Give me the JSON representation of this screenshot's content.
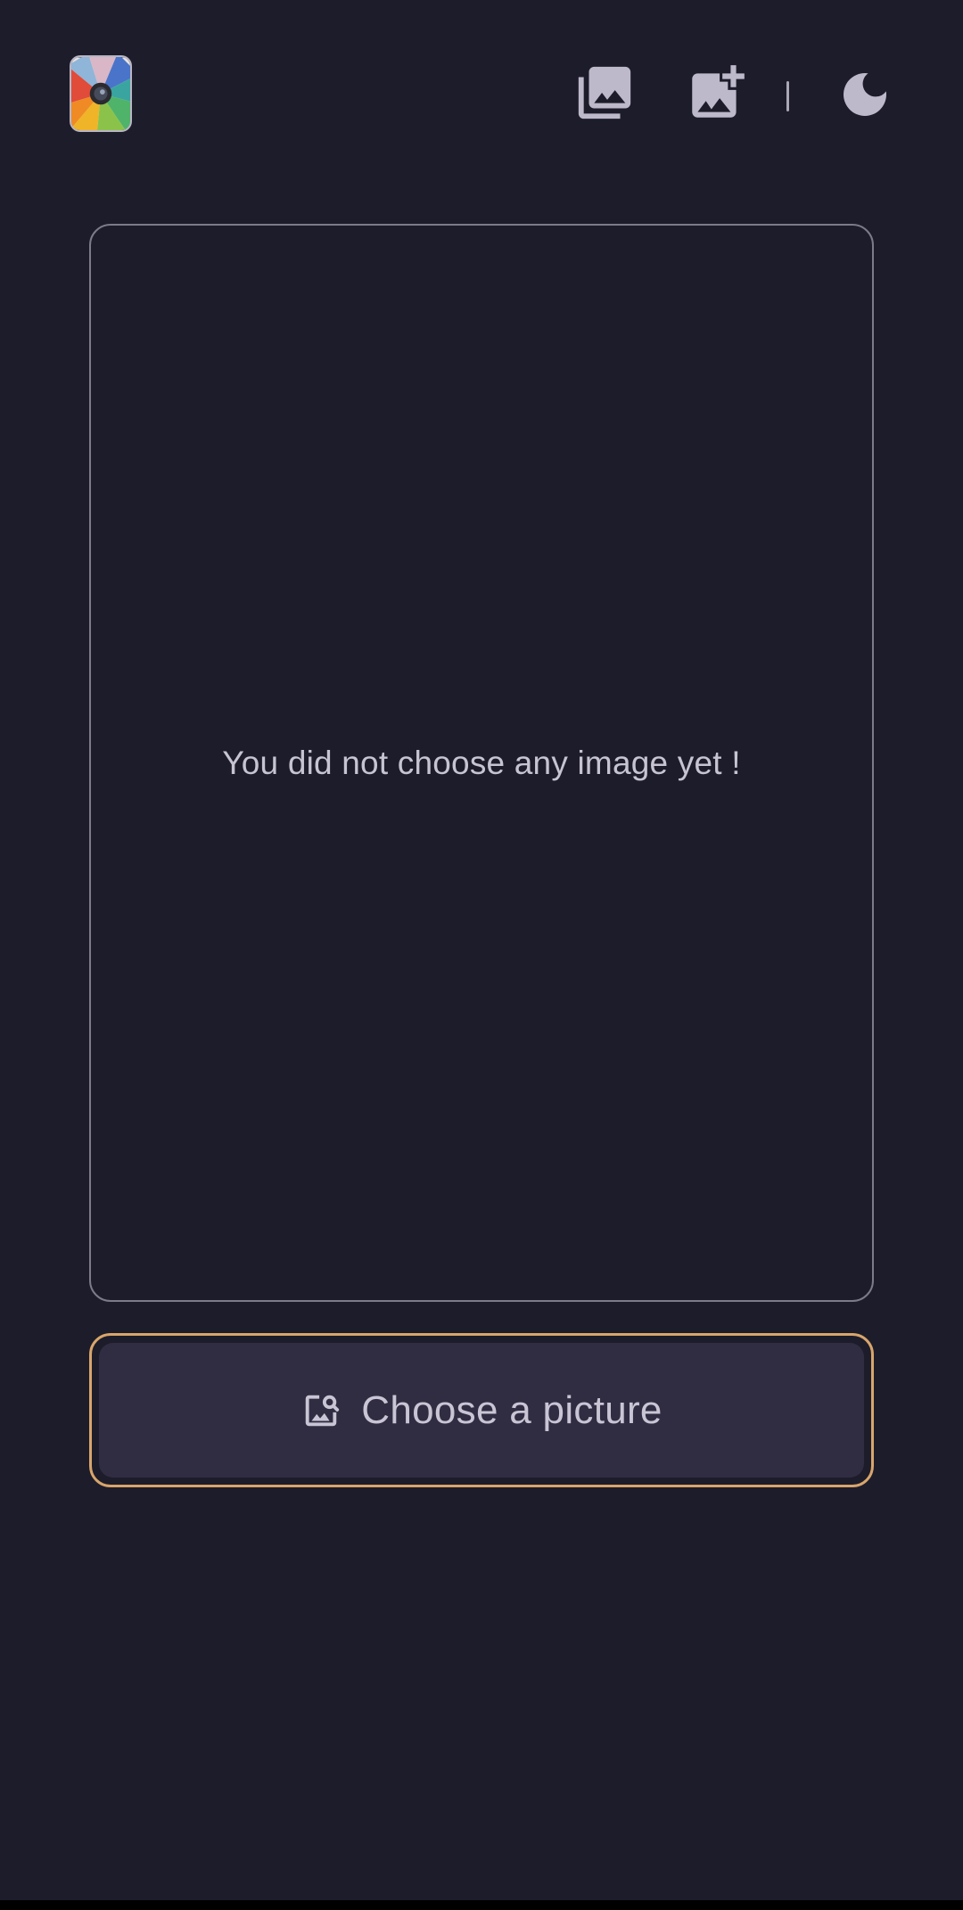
{
  "header": {
    "logo_icon": "app-logo-colorful-aperture",
    "actions": [
      {
        "name": "gallery-icon"
      },
      {
        "name": "add-image-icon"
      },
      {
        "name": "moon-icon"
      }
    ]
  },
  "preview": {
    "empty_message": "You did not choose any image yet !"
  },
  "choose_button": {
    "label": "Choose a picture",
    "icon": "image-search-icon"
  },
  "colors": {
    "background": "#1d1c2b",
    "icon": "#bdb9cb",
    "preview_border": "#7d7b89",
    "button_fill": "#302d43",
    "button_outline": "#d8a56b"
  }
}
